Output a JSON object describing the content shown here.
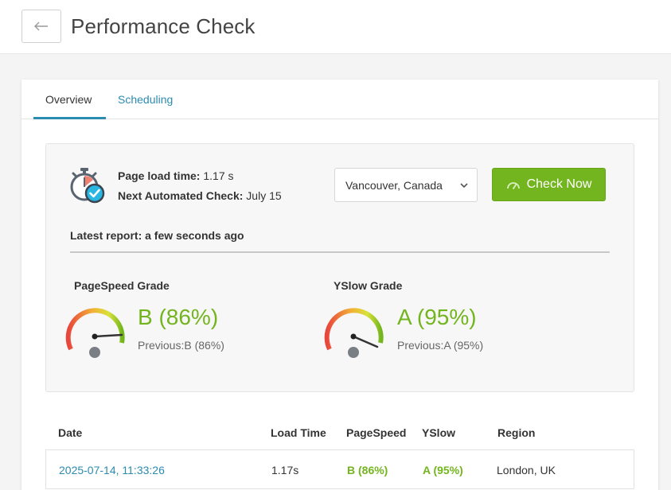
{
  "header": {
    "title": "Performance Check",
    "back_icon": "back-arrow-icon"
  },
  "tabs": [
    {
      "label": "Overview",
      "active": true
    },
    {
      "label": "Scheduling",
      "active": false
    }
  ],
  "summary": {
    "page_load_label": "Page load time:",
    "page_load_value": "1.17 s",
    "next_check_label": "Next Automated Check:",
    "next_check_value": "July 15",
    "latest_report": "Latest report: a few seconds ago",
    "region_selected": "Vancouver, Canada",
    "check_button": "Check Now"
  },
  "grades": [
    {
      "title": "PageSpeed Grade",
      "value": "B (86%)",
      "previous": "Previous:B (86%)",
      "percent": 86
    },
    {
      "title": "YSlow Grade",
      "value": "A (95%)",
      "previous": "Previous:A (95%)",
      "percent": 95
    }
  ],
  "table": {
    "headers": [
      "Date",
      "Load Time",
      "PageSpeed",
      "YSlow",
      "Region"
    ],
    "rows": [
      [
        "2025-07-14, 11:33:26",
        "1.17s",
        "B (86%)",
        "A (95%)",
        "London, UK"
      ]
    ]
  },
  "colors": {
    "accent_blue": "#2b8bb0",
    "accent_green": "#73b51e"
  }
}
